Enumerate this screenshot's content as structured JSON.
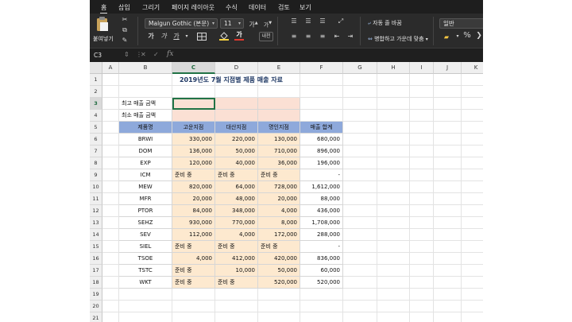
{
  "ribbon_tabs": [
    "홈",
    "삽입",
    "그리기",
    "페이지 레이아웃",
    "수식",
    "데이터",
    "검토",
    "보기"
  ],
  "ribbon": {
    "paste_label": "붙여넣기",
    "font_name": "Malgun Gothic (본문)",
    "font_size": "11",
    "grow_font": "가",
    "shrink_font": "가",
    "bold": "가",
    "italic": "가",
    "underline": "가",
    "font_color_char": "가",
    "phonetic": "내천",
    "wrap_text": "자동 줄 바꿈",
    "merge_center": "병합하고 가운데 맞춤",
    "number_format": "일반",
    "percent": "%",
    "colors": {
      "font_color": "#e03a2f",
      "fill_color": "#f4d03f",
      "accent": "#217346"
    }
  },
  "formula_bar": {
    "name_box": "C3",
    "fx": "fx",
    "formula": ""
  },
  "sheet": {
    "columns": [
      "A",
      "B",
      "C",
      "D",
      "E",
      "F",
      "G",
      "H",
      "I",
      "J",
      "K"
    ],
    "selected_column": "C",
    "rows": [
      "1",
      "2",
      "3",
      "4",
      "5",
      "6",
      "7",
      "8",
      "9",
      "10",
      "11",
      "12",
      "13",
      "14",
      "15",
      "16",
      "17",
      "18",
      "19",
      "20",
      "21"
    ],
    "selected_row": "3",
    "title": "2019년도 7월 지점별 제품  매출 자료",
    "summary_labels": [
      "최고 매출 금액",
      "최소 매출 금액"
    ],
    "headers": [
      "제품명",
      "고운지점",
      "대산지점",
      "명인지점",
      "매출 합계"
    ],
    "data_rows": [
      [
        "BRWI",
        "330,000",
        "220,000",
        "130,000",
        "680,000"
      ],
      [
        "DOM",
        "136,000",
        "50,000",
        "710,000",
        "896,000"
      ],
      [
        "EXP",
        "120,000",
        "40,000",
        "36,000",
        "196,000"
      ],
      [
        "ICM",
        "준비 중",
        "준비 중",
        "준비 중",
        "-"
      ],
      [
        "MEW",
        "820,000",
        "64,000",
        "728,000",
        "1,612,000"
      ],
      [
        "MFR",
        "20,000",
        "48,000",
        "20,000",
        "88,000"
      ],
      [
        "PTOR",
        "84,000",
        "348,000",
        "4,000",
        "436,000"
      ],
      [
        "SEHZ",
        "930,000",
        "770,000",
        "8,000",
        "1,708,000"
      ],
      [
        "SEV",
        "112,000",
        "4,000",
        "172,000",
        "288,000"
      ],
      [
        "SIEL",
        "준비 중",
        "준비 중",
        "준비 중",
        "-"
      ],
      [
        "TSOE",
        "4,000",
        "412,000",
        "420,000",
        "836,000"
      ],
      [
        "TSTC",
        "준비 중",
        "10,000",
        "50,000",
        "60,000"
      ],
      [
        "WKT",
        "준비 중",
        "준비 중",
        "520,000",
        "520,000"
      ]
    ],
    "colors": {
      "header_fill": "#8ea9db",
      "data_fill": "#fde9cf",
      "summary_fill": "#fbe0d4",
      "name_fill": "#ffffff"
    }
  }
}
